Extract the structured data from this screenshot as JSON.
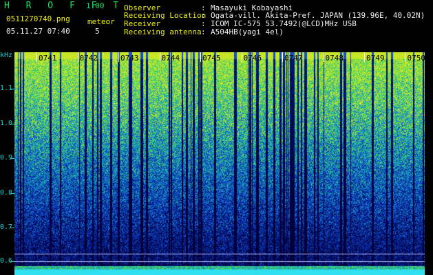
{
  "app": {
    "name": "H R O F F T",
    "version": "1.00"
  },
  "file": {
    "name": "0511270740.png",
    "timestamp": "05.11.27 07:40"
  },
  "meteor": {
    "label": "meteor",
    "count": "5"
  },
  "info": [
    {
      "label": "Observer",
      "sep": ":",
      "value": "Masayuki Kobayashi"
    },
    {
      "label": "Receiving Location",
      "sep": ":",
      "value": "Ogata-vill. Akita-Pref. JAPAN (139.96E, 40.02N)"
    },
    {
      "label": "Receiver",
      "sep": ":",
      "value": "ICOM IC-575 53.7492(@LCD)MHz USB"
    },
    {
      "label": "Receiving antenna",
      "sep": ":",
      "value": "A504HB(yagi 4el)"
    }
  ],
  "axis": {
    "unit": "kHz",
    "ticks": [
      "1.1",
      "1.0",
      "0.9",
      "0.8",
      "0.7",
      "0.6"
    ]
  },
  "time_labels": [
    "0741",
    "0742",
    "0743",
    "0744",
    "0745",
    "0746",
    "0747",
    "0748",
    "0749",
    "0750"
  ],
  "colors": {
    "green": "#20e060",
    "yellow": "#f0f010",
    "cyan": "#30f0f0",
    "white": "#f0f0f0"
  }
}
